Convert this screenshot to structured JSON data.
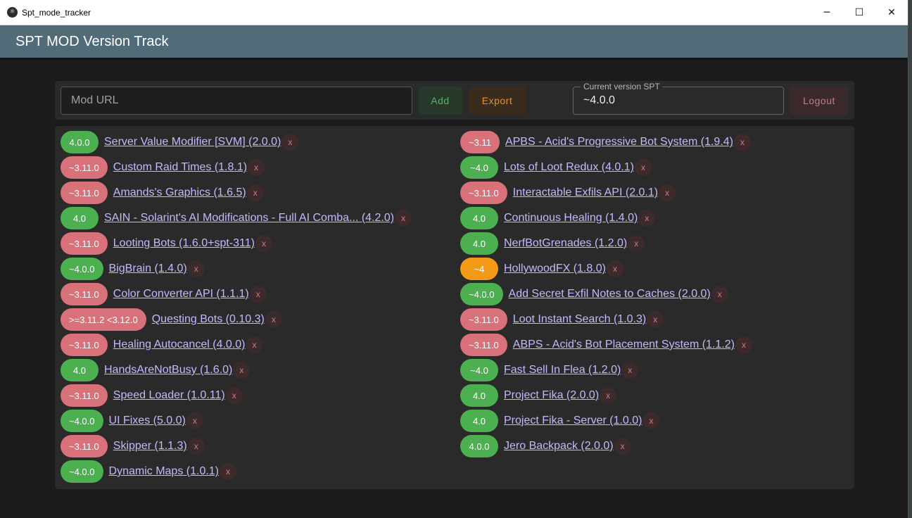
{
  "window": {
    "title": "Spt_mode_tracker",
    "app_icon": "electron-icon",
    "controls": {
      "minimize": "─",
      "maximize": "☐",
      "close": "✕"
    }
  },
  "header": {
    "title": "SPT MOD Version Track"
  },
  "toolbar": {
    "url_placeholder": "Mod URL",
    "url_value": "",
    "add_label": "Add",
    "export_label": "Export",
    "version_legend": "Current version SPT",
    "version_value": "~4.0.0",
    "logout_label": "Logout"
  },
  "colors": {
    "badge_green": "#4caf50",
    "badge_red": "#d9717a",
    "badge_orange": "#f59a16",
    "link": "#c5b8ff",
    "appbar": "#526b78"
  },
  "mods_left": [
    {
      "version": "4.0.0",
      "status": "green",
      "name": "Server Value Modifier [SVM] (2.0.0)",
      "remove": "x"
    },
    {
      "version": "~3.11.0",
      "status": "red",
      "name": "Custom Raid Times (1.8.1)",
      "remove": "x"
    },
    {
      "version": "~3.11.0",
      "status": "red",
      "name": "Amands's Graphics (1.6.5)",
      "remove": "x"
    },
    {
      "version": "4.0",
      "status": "green",
      "name": "SAIN - Solarint's AI Modifications - Full AI Comba... (4.2.0)",
      "remove": "x"
    },
    {
      "version": "~3.11.0",
      "status": "red",
      "name": "Looting Bots (1.6.0+spt-311)",
      "remove": "x"
    },
    {
      "version": "~4.0.0",
      "status": "green",
      "name": "BigBrain (1.4.0)",
      "remove": "x"
    },
    {
      "version": "~3.11.0",
      "status": "red",
      "name": "Color Converter API (1.1.1)",
      "remove": "x"
    },
    {
      "version": ">=3.11.2 <3.12.0",
      "status": "red",
      "name": "Questing Bots (0.10.3)",
      "remove": "x"
    },
    {
      "version": "~3.11.0",
      "status": "red",
      "name": "Healing Autocancel (4.0.0)",
      "remove": "x"
    },
    {
      "version": "4.0",
      "status": "green",
      "name": "HandsAreNotBusy (1.6.0)",
      "remove": "x"
    },
    {
      "version": "~3.11.0",
      "status": "red",
      "name": "Speed Loader (1.0.11)",
      "remove": "x"
    },
    {
      "version": "~4.0.0",
      "status": "green",
      "name": "UI Fixes (5.0.0)",
      "remove": "x"
    },
    {
      "version": "~3.11.0",
      "status": "red",
      "name": "Skipper (1.1.3)",
      "remove": "x"
    },
    {
      "version": "~4.0.0",
      "status": "green",
      "name": "Dynamic Maps (1.0.1)",
      "remove": "x"
    }
  ],
  "mods_right": [
    {
      "version": "~3.11",
      "status": "red",
      "name": "APBS - Acid's Progressive Bot System (1.9.4)",
      "remove": "x"
    },
    {
      "version": "~4.0",
      "status": "green",
      "name": "Lots of Loot Redux (4.0.1)",
      "remove": "x"
    },
    {
      "version": "~3.11.0",
      "status": "red",
      "name": "Interactable Exfils API (2.0.1)",
      "remove": "x"
    },
    {
      "version": "4.0",
      "status": "green",
      "name": "Continuous Healing (1.4.0)",
      "remove": "x"
    },
    {
      "version": "4.0",
      "status": "green",
      "name": "NerfBotGrenades (1.2.0)",
      "remove": "x"
    },
    {
      "version": "~4",
      "status": "orange",
      "name": "HollywoodFX (1.8.0)",
      "remove": "x"
    },
    {
      "version": "~4.0.0",
      "status": "green",
      "name": "Add Secret Exfil Notes to Caches (2.0.0)",
      "remove": "x"
    },
    {
      "version": "~3.11.0",
      "status": "red",
      "name": "Loot Instant Search (1.0.3)",
      "remove": "x"
    },
    {
      "version": "~3.11.0",
      "status": "red",
      "name": "ABPS - Acid's Bot Placement System (1.1.2)",
      "remove": "x"
    },
    {
      "version": "~4.0",
      "status": "green",
      "name": "Fast Sell In Flea (1.2.0)",
      "remove": "x"
    },
    {
      "version": "4.0",
      "status": "green",
      "name": "Project Fika (2.0.0)",
      "remove": "x"
    },
    {
      "version": "4.0",
      "status": "green",
      "name": "Project Fika - Server (1.0.0)",
      "remove": "x"
    },
    {
      "version": "4.0.0",
      "status": "green",
      "name": "Jero Backpack (2.0.0)",
      "remove": "x"
    }
  ]
}
